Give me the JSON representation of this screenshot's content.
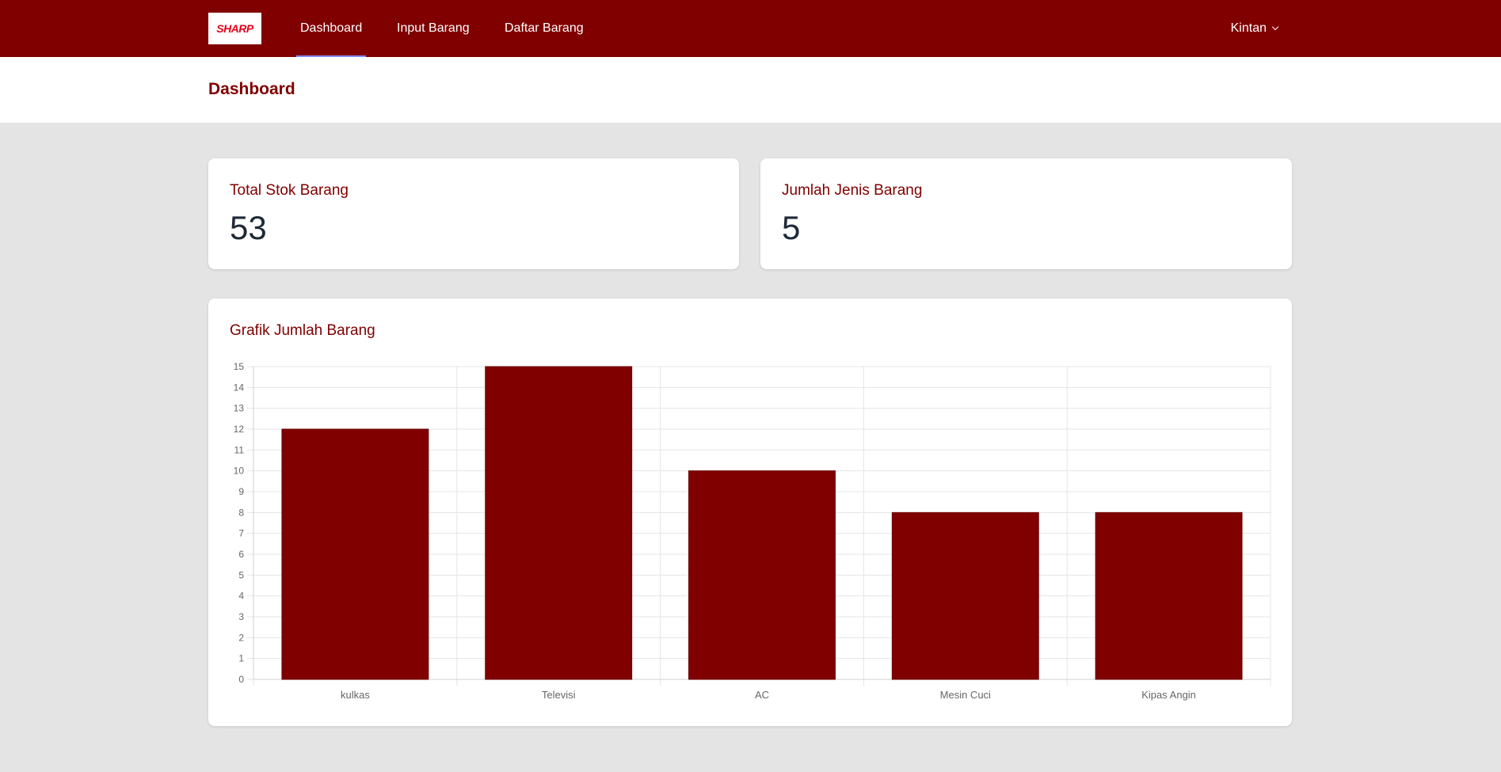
{
  "brand": {
    "logo_text": "SHARP",
    "color": "#800000"
  },
  "nav": {
    "items": [
      {
        "label": "Dashboard",
        "active": true
      },
      {
        "label": "Input Barang",
        "active": false
      },
      {
        "label": "Daftar Barang",
        "active": false
      }
    ],
    "user": "Kintan"
  },
  "page": {
    "title": "Dashboard"
  },
  "stats": {
    "total_stock": {
      "label": "Total Stok Barang",
      "value": "53"
    },
    "item_types": {
      "label": "Jumlah Jenis Barang",
      "value": "5"
    }
  },
  "chart_card": {
    "title": "Grafik Jumlah Barang"
  },
  "chart_data": {
    "type": "bar",
    "title": "Grafik Jumlah Barang",
    "categories": [
      "kulkas",
      "Televisi",
      "AC",
      "Mesin Cuci",
      "Kipas Angin"
    ],
    "values": [
      12,
      15,
      10,
      8,
      8
    ],
    "ylim": [
      0,
      15
    ],
    "ytick_step": 1,
    "bar_color": "#800000",
    "grid": true,
    "legend": "none"
  }
}
